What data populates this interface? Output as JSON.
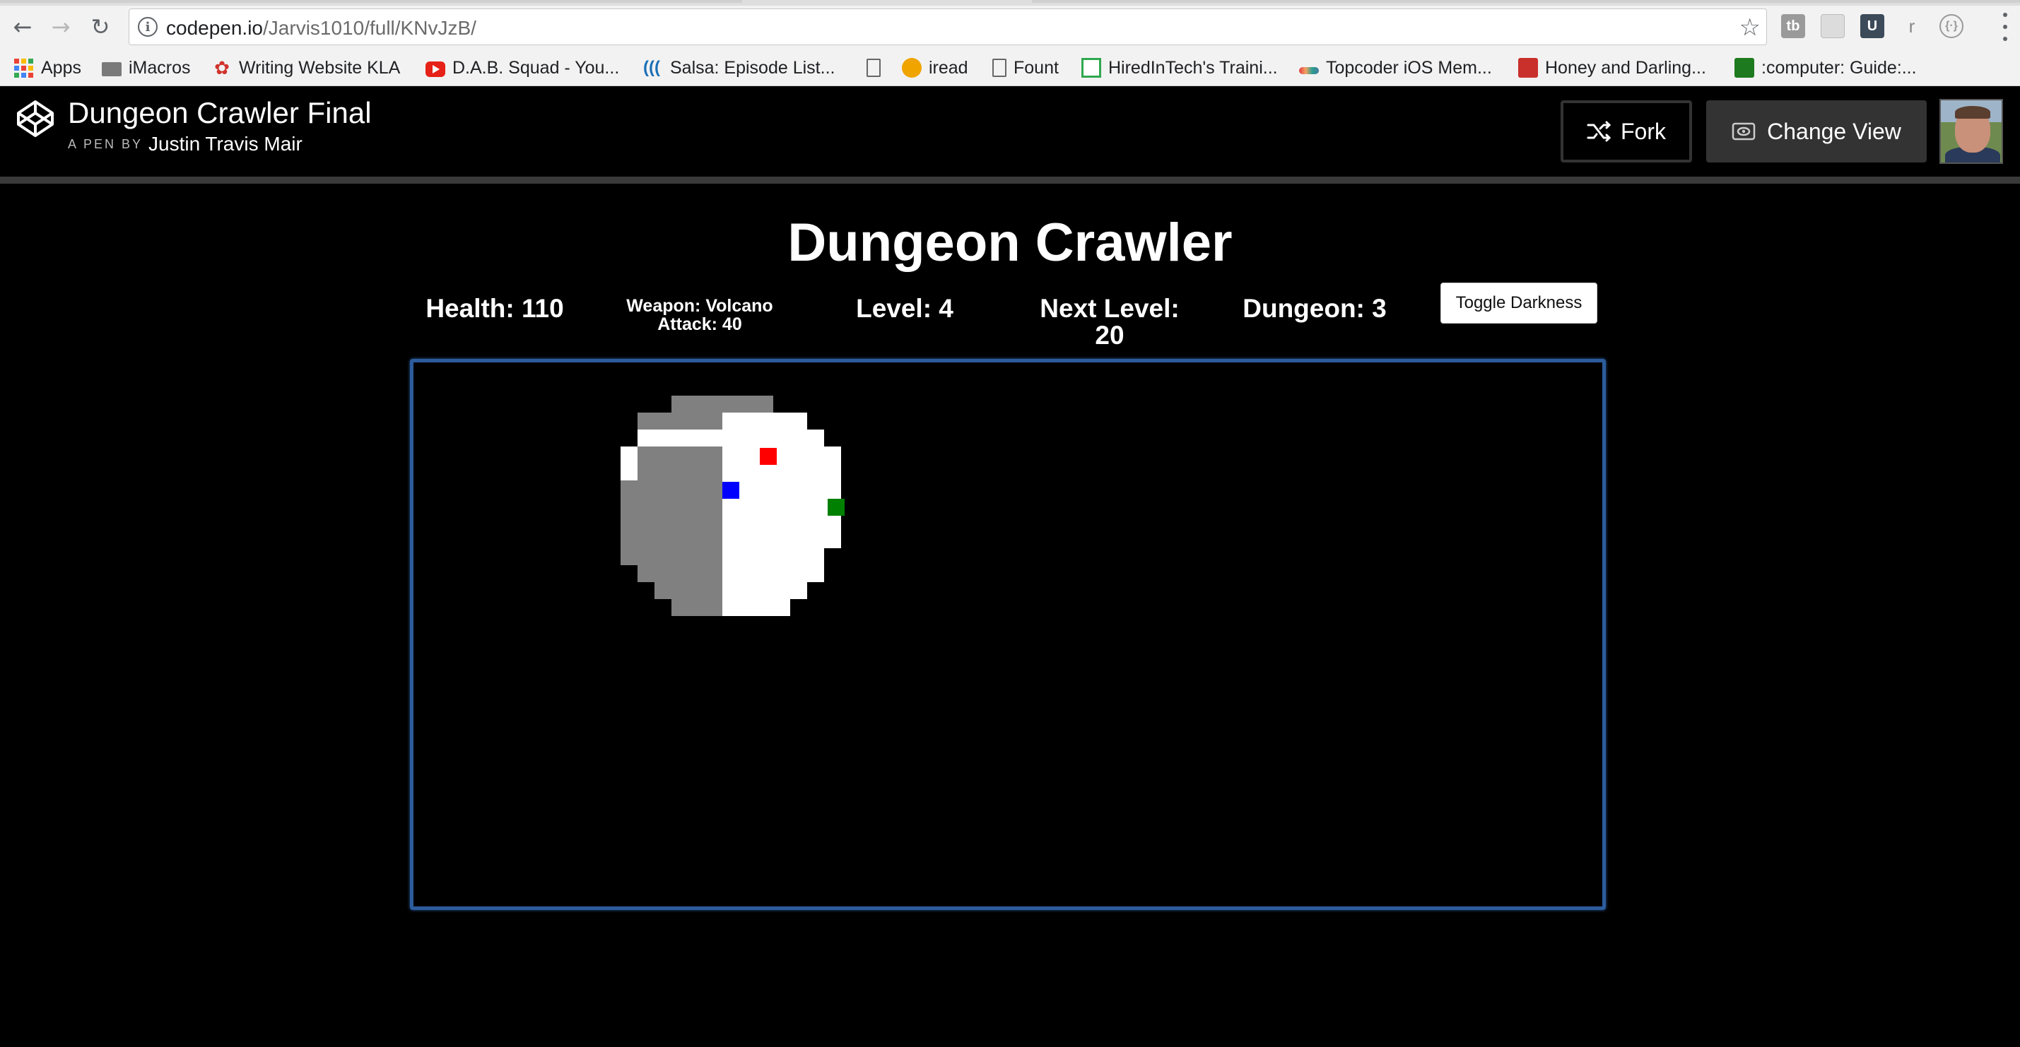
{
  "browser": {
    "url_host": "codepen.io",
    "url_path": "/Jarvis1010/full/KNvJzB/",
    "bookmarks": [
      {
        "label": "Apps",
        "icon": "apps-grid-icon"
      },
      {
        "label": "iMacros",
        "icon": "folder-icon"
      },
      {
        "label": "Writing Website KLA",
        "icon": "writing-icon"
      },
      {
        "label": "D.A.B. Squad - You...",
        "icon": "youtube-icon"
      },
      {
        "label": "Salsa: Episode List...",
        "icon": "salsa-icon"
      },
      {
        "label": "",
        "icon": "page-icon"
      },
      {
        "label": "iread",
        "icon": "iread-icon"
      },
      {
        "label": "Fount",
        "icon": "page-icon"
      },
      {
        "label": "HiredInTech's Traini...",
        "icon": "hiredintech-icon"
      },
      {
        "label": "Topcoder iOS Mem...",
        "icon": "topcoder-icon"
      },
      {
        "label": "Honey and Darling...",
        "icon": "honey-icon"
      },
      {
        "label": ":computer: Guide:...",
        "icon": "guide-icon"
      }
    ],
    "extensions": [
      {
        "label": "tb",
        "icon": "tb-extension-icon"
      },
      {
        "label": "",
        "icon": "extension-icon"
      },
      {
        "label": "",
        "icon": "udacity-extension-icon"
      },
      {
        "label": "r",
        "icon": "r-extension-icon"
      },
      {
        "label": "",
        "icon": "code-extension-icon"
      }
    ]
  },
  "codepen": {
    "pen_title": "Dungeon Crawler Final",
    "by_label": "A PEN BY",
    "author": "Justin Travis Mair",
    "fork_label": "Fork",
    "change_view_label": "Change View"
  },
  "game": {
    "title": "Dungeon Crawler",
    "health": "Health: 110",
    "weapon": "Weapon: Volcano",
    "attack": "Attack: 40",
    "level": "Level: 4",
    "next_level_label": "Next Level:",
    "next_level_value": "20",
    "dungeon": "Dungeon: 3",
    "toggle_label": "Toggle Darkness"
  },
  "colors": {
    "floor": "#ffffff",
    "wall": "#808080",
    "player": "#0000ff",
    "enemy": "#ff0000",
    "health_item": "#008000",
    "board_border": "#2c5c9c"
  }
}
